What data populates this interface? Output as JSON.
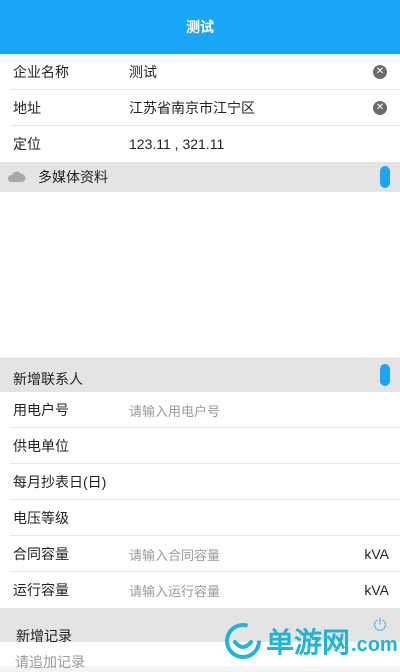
{
  "header": {
    "title": "测试"
  },
  "form": {
    "company_name": {
      "label": "企业名称",
      "value": "测试"
    },
    "address": {
      "label": "地址",
      "value": "江苏省南京市江宁区"
    },
    "location": {
      "label": "定位",
      "value": "123.11 , 321.11"
    }
  },
  "media": {
    "title": "多媒体资料"
  },
  "contact": {
    "title": "新增联系人",
    "fields": [
      {
        "label": "用电户号",
        "placeholder": "请输入用电户号"
      },
      {
        "label": "供电单位",
        "placeholder": ""
      },
      {
        "label": "每月抄表日(日)",
        "placeholder": ""
      },
      {
        "label": "电压等级",
        "placeholder": ""
      },
      {
        "label": "合同容量",
        "placeholder": "请输入合同容量",
        "unit": "kVA"
      },
      {
        "label": "运行容量",
        "placeholder": "请输入运行容量",
        "unit": "kVA"
      }
    ]
  },
  "records": {
    "title": "新增记录",
    "add_placeholder": "请追加记录"
  },
  "watermark": {
    "brand": "单游网",
    "suffix": ".com"
  },
  "colors": {
    "accent": "#1aa6f8",
    "watermark": "#1eb5d6"
  }
}
